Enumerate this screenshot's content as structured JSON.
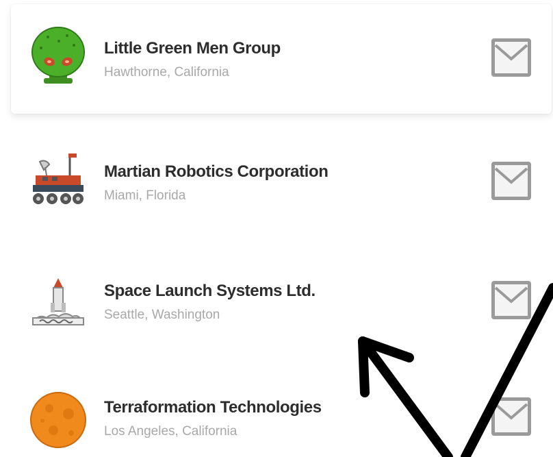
{
  "companies": [
    {
      "name": "Little Green Men Group",
      "location": "Hawthorne, California",
      "logo_icon": "green-alien-icon",
      "selected": true
    },
    {
      "name": "Martian Robotics Corporation",
      "location": "Miami, Florida",
      "logo_icon": "mars-rover-icon",
      "selected": false
    },
    {
      "name": "Space Launch Systems Ltd.",
      "location": "Seattle, Washington",
      "logo_icon": "rocket-launch-icon",
      "selected": false
    },
    {
      "name": "Terraformation Technologies",
      "location": "Los Angeles, California",
      "logo_icon": "orange-planet-icon",
      "selected": false
    }
  ],
  "action_icon": "mail-icon",
  "annotation": {
    "icon": "arrow-pointer-annotation",
    "color": "#000000"
  },
  "colors": {
    "name_text": "#2d2d2d",
    "location_text": "#a8a8a8",
    "mail_icon": "#9a9a9a",
    "alien_green": "#4caf2a",
    "planet_orange": "#f08a1c"
  }
}
